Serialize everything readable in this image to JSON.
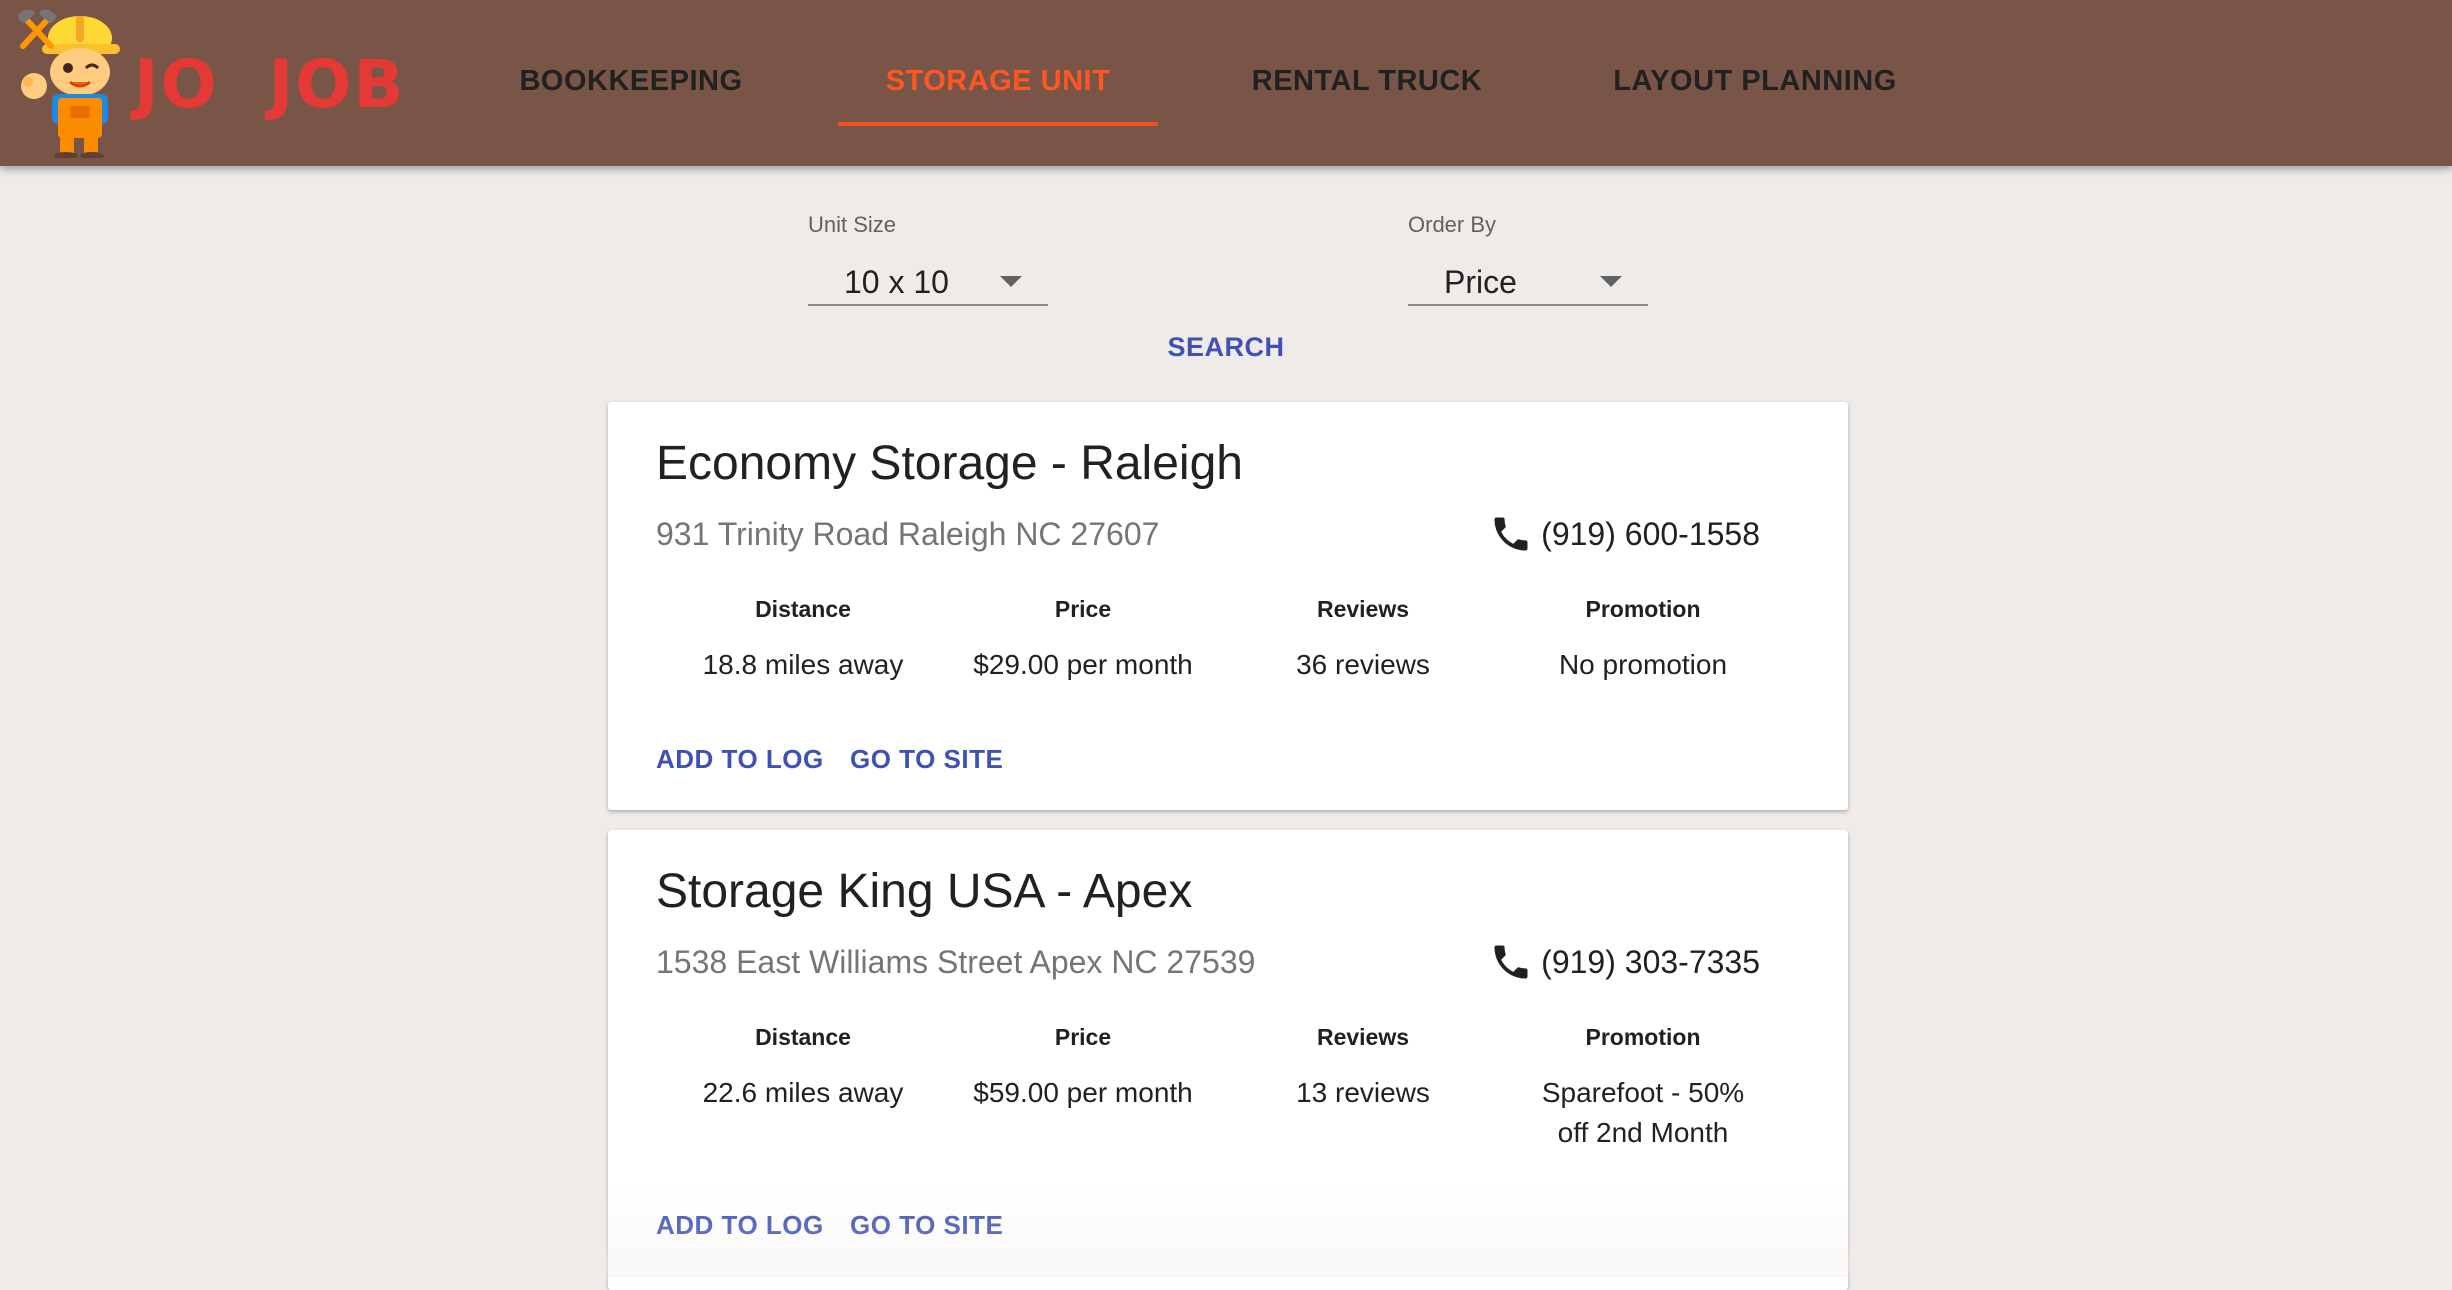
{
  "app": {
    "logo_text_left": "JO",
    "logo_text_right": "JOB",
    "brand_color": "#e53935",
    "header_color": "#795548",
    "accent_color": "#ff5722",
    "link_color": "#3f51b5"
  },
  "nav": {
    "tabs": [
      {
        "label": "BOOKKEEPING",
        "active": false
      },
      {
        "label": "STORAGE UNIT",
        "active": true
      },
      {
        "label": "RENTAL TRUCK",
        "active": false
      },
      {
        "label": "LAYOUT PLANNING",
        "active": false
      }
    ]
  },
  "search": {
    "unit_size": {
      "label": "Unit Size",
      "value": "10 x 10"
    },
    "order_by": {
      "label": "Order By",
      "value": "Price"
    },
    "button_label": "SEARCH"
  },
  "results": [
    {
      "name": "Economy Storage - Raleigh",
      "address": "931 Trinity Road Raleigh NC 27607",
      "phone": "(919) 600-1558",
      "stats": {
        "distance_label": "Distance",
        "distance": "18.8 miles away",
        "price_label": "Price",
        "price": "$29.00 per month",
        "reviews_label": "Reviews",
        "reviews": "36 reviews",
        "promotion_label": "Promotion",
        "promotion": "No promotion"
      },
      "actions": {
        "add_to_log": "ADD TO LOG",
        "go_to_site": "GO TO SITE"
      }
    },
    {
      "name": "Storage King USA - Apex",
      "address": "1538 East Williams Street Apex NC 27539",
      "phone": "(919) 303-7335",
      "stats": {
        "distance_label": "Distance",
        "distance": "22.6 miles away",
        "price_label": "Price",
        "price": "$59.00 per month",
        "reviews_label": "Reviews",
        "reviews": "13 reviews",
        "promotion_label": "Promotion",
        "promotion": "Sparefoot - 50% off 2nd Month"
      },
      "actions": {
        "add_to_log": "ADD TO LOG",
        "go_to_site": "GO TO SITE"
      }
    }
  ],
  "icons": {
    "logo_mascot": "construction-worker-icon",
    "logo_tools": "crossed-hammers-icon",
    "phone": "phone-icon",
    "dropdown": "caret-down-icon"
  }
}
